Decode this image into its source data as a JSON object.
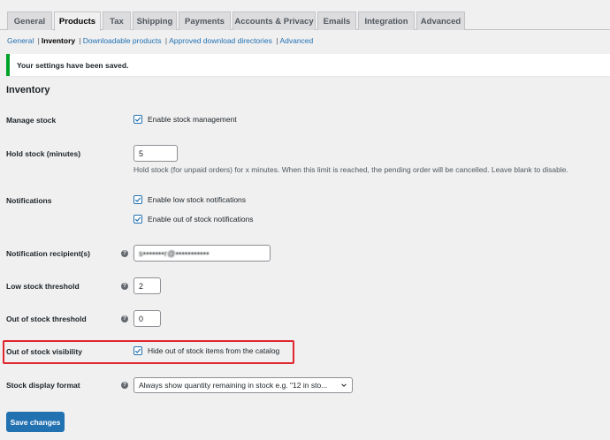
{
  "tabs": [
    {
      "label": "General",
      "active": false
    },
    {
      "label": "Products",
      "active": true
    },
    {
      "label": "Tax",
      "active": false
    },
    {
      "label": "Shipping",
      "active": false
    },
    {
      "label": "Payments",
      "active": false
    },
    {
      "label": "Accounts & Privacy",
      "active": false
    },
    {
      "label": "Emails",
      "active": false
    },
    {
      "label": "Integration",
      "active": false
    },
    {
      "label": "Advanced",
      "active": false
    }
  ],
  "subnav": {
    "general": "General",
    "inventory": "Inventory",
    "downloadable": "Downloadable products",
    "approved_dirs": "Approved download directories",
    "advanced": "Advanced",
    "separator": "|"
  },
  "notice": {
    "text": "Your settings have been saved.",
    "color": "#00a32a"
  },
  "section_title": "Inventory",
  "fields": {
    "manage_stock": {
      "label": "Manage stock",
      "checkbox_label": "Enable stock management",
      "checked": true
    },
    "hold_stock": {
      "label": "Hold stock (minutes)",
      "value": "5",
      "description": "Hold stock (for unpaid orders) for x minutes. When this limit is reached, the pending order will be cancelled. Leave blank to disable."
    },
    "notifications": {
      "label": "Notifications",
      "low_stock_label": "Enable low stock notifications",
      "low_stock_checked": true,
      "out_of_stock_label": "Enable out of stock notifications",
      "out_of_stock_checked": true
    },
    "notification_recipient": {
      "label": "Notification recipient(s)",
      "value": "s•••••••r@•••••••••••"
    },
    "low_stock_threshold": {
      "label": "Low stock threshold",
      "value": "2"
    },
    "out_of_stock_threshold": {
      "label": "Out of stock threshold",
      "value": "0"
    },
    "out_of_stock_visibility": {
      "label": "Out of stock visibility",
      "checkbox_label": "Hide out of stock items from the catalog",
      "checked": true
    },
    "stock_display_format": {
      "label": "Stock display format",
      "selected": "Always show quantity remaining in stock e.g. \"12 in sto..."
    }
  },
  "help_icon_glyph": "?",
  "save_button": "Save changes",
  "colors": {
    "accent": "#2271b1",
    "highlight": "#e0262e",
    "background": "#f0f0f1"
  },
  "icons": {
    "help": "help-icon",
    "checkmark": "checkmark-icon",
    "chevron": "chevron-down-icon"
  }
}
